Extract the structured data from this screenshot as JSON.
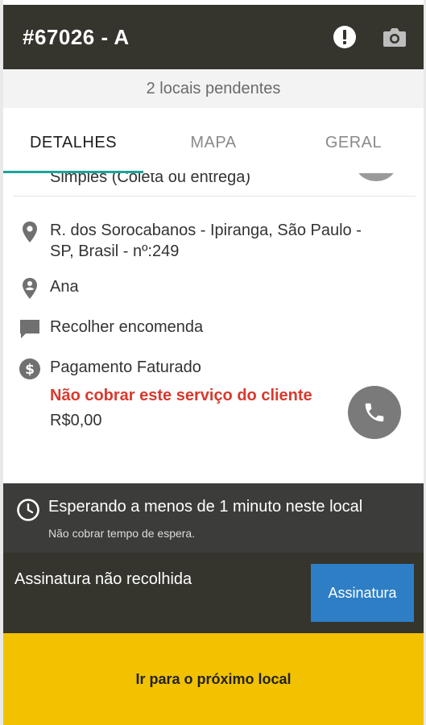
{
  "header": {
    "title": "#67026 - A",
    "alert_icon": "alert-circle-icon",
    "camera_icon": "camera-icon"
  },
  "pending": {
    "text": "2 locais pendentes"
  },
  "tabs": [
    {
      "label": "DETALHES",
      "active": true
    },
    {
      "label": "MAPA",
      "active": false
    },
    {
      "label": "GERAL",
      "active": false
    }
  ],
  "details": {
    "service_type": "Simples (Coleta ou entrega)",
    "address_line1": "R. dos Sorocabanos - Ipiranga, São Paulo -",
    "address_line2": "SP, Brasil - nº:249",
    "contact": "Ana",
    "instruction": "Recolher encomenda",
    "payment": "Pagamento Faturado",
    "warning": "Não cobrar este serviço do cliente",
    "price": "R$0,00"
  },
  "waiting": {
    "main": "Esperando a menos de 1 minuto neste local",
    "sub": "Não cobrar tempo de espera."
  },
  "signature": {
    "label": "Assinatura não recolhida",
    "button": "Assinatura"
  },
  "next_button": "Ir para o próximo local",
  "colors": {
    "header_bg": "#35342d",
    "accent_tab": "#1aa59a",
    "warning": "#d9392e",
    "signature_button": "#2d7ec5",
    "next_button": "#f2c200"
  }
}
